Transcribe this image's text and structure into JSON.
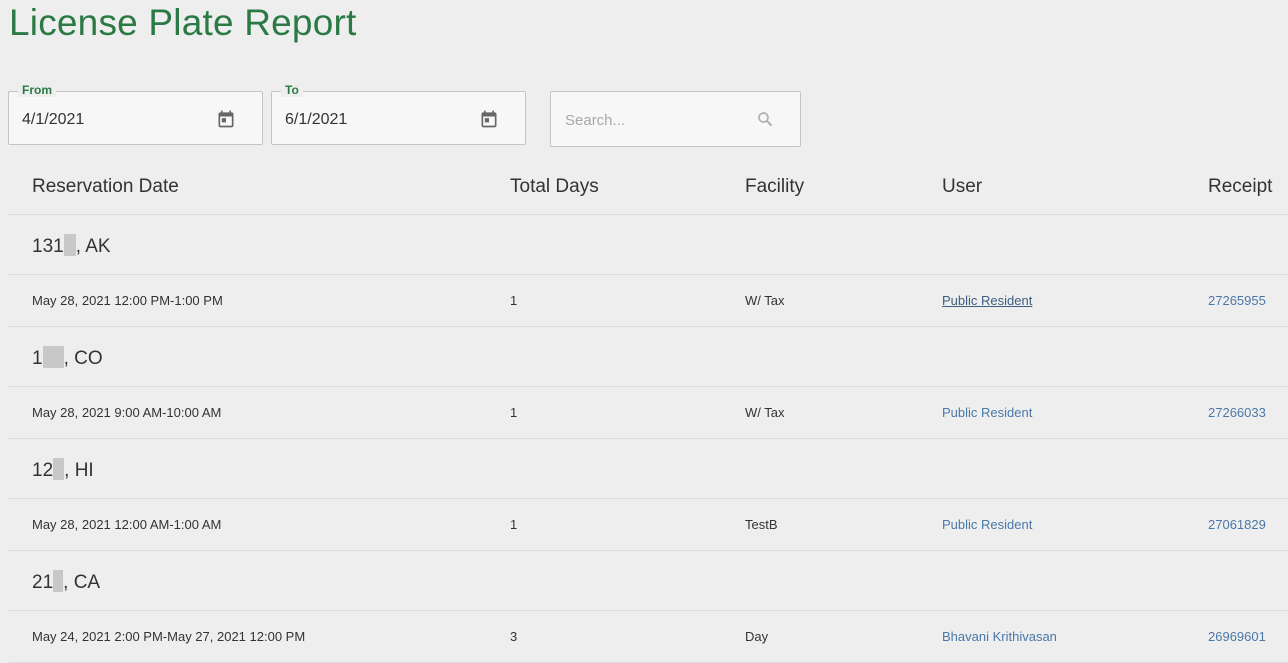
{
  "page": {
    "title": "License Plate Report"
  },
  "filters": {
    "from": {
      "label": "From",
      "value": "4/1/2021",
      "icon": "calendar-icon"
    },
    "to": {
      "label": "To",
      "value": "6/1/2021",
      "icon": "calendar-icon"
    },
    "search": {
      "placeholder": "Search...",
      "value": "",
      "icon": "search-icon"
    }
  },
  "table": {
    "columns": [
      "Reservation Date",
      "Total Days",
      "Facility",
      "User",
      "Receipt"
    ],
    "groups": [
      {
        "plate_prefix": "131",
        "plate_suffix": ", AK",
        "rows": [
          {
            "date": "May 28, 2021 12:00 PM-1:00 PM",
            "days": "1",
            "facility": "W/ Tax",
            "user": "Public Resident",
            "receipt": "27265955",
            "user_underlined": true
          }
        ]
      },
      {
        "plate_prefix": "1",
        "plate_suffix": ", CO",
        "rows": [
          {
            "date": "May 28, 2021 9:00 AM-10:00 AM",
            "days": "1",
            "facility": "W/ Tax",
            "user": "Public Resident",
            "receipt": "27266033",
            "user_underlined": false
          }
        ]
      },
      {
        "plate_prefix": "12",
        "plate_suffix": ", HI",
        "rows": [
          {
            "date": "May 28, 2021 12:00 AM-1:00 AM",
            "days": "1",
            "facility": "TestB",
            "user": "Public Resident",
            "receipt": "27061829",
            "user_underlined": false
          }
        ]
      },
      {
        "plate_prefix": "21",
        "plate_suffix": ", CA",
        "rows": [
          {
            "date": "May 24, 2021 2:00 PM-May 27, 2021 12:00 PM",
            "days": "3",
            "facility": "Day",
            "user": "Bhavani Krithivasan",
            "receipt": "26969601",
            "user_underlined": false
          }
        ]
      }
    ]
  },
  "colors": {
    "accent": "#2b7a45",
    "link": "#4a78a8",
    "background": "#eeeeee"
  }
}
